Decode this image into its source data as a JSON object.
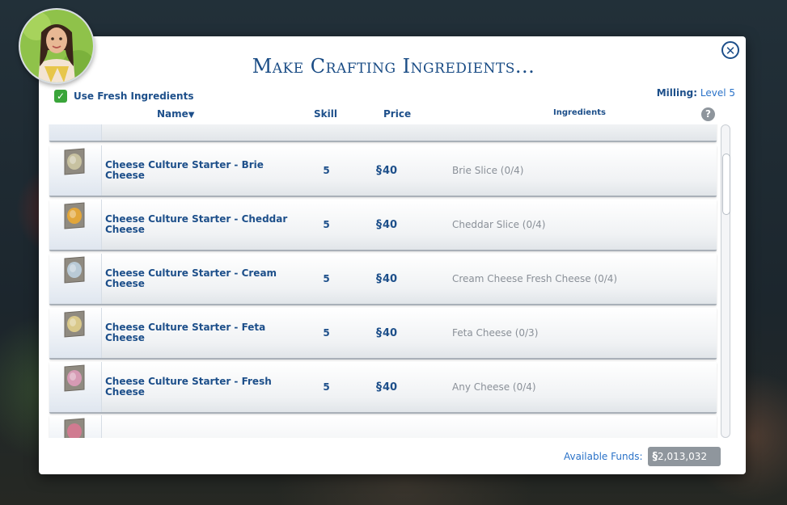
{
  "dialog": {
    "title": "Make Crafting Ingredients...",
    "use_fresh_label": "Use Fresh Ingredients",
    "use_fresh_checked": true,
    "skill_label": "Milling:",
    "skill_level": "Level 5"
  },
  "columns": {
    "name": "Name",
    "skill": "Skill",
    "price": "Price",
    "ingredients": "Ingredients"
  },
  "currency_symbol": "§",
  "rows": [
    {
      "name": "Cheese Culture Starter - Brie Cheese",
      "skill": "5",
      "price": "40",
      "ingredients": "Brie Slice (0/4)",
      "accent": "#c7c1a0"
    },
    {
      "name": "Cheese Culture Starter - Cheddar Cheese",
      "skill": "5",
      "price": "40",
      "ingredients": "Cheddar Slice (0/4)",
      "accent": "#e2a63a"
    },
    {
      "name": "Cheese Culture Starter - Cream Cheese",
      "skill": "5",
      "price": "40",
      "ingredients": "Cream Cheese Fresh Cheese (0/4)",
      "accent": "#b9cad6"
    },
    {
      "name": "Cheese Culture Starter - Feta Cheese",
      "skill": "5",
      "price": "40",
      "ingredients": "Feta Cheese (0/3)",
      "accent": "#d9c88a"
    },
    {
      "name": "Cheese Culture Starter - Fresh Cheese",
      "skill": "5",
      "price": "40",
      "ingredients": "Any Cheese (0/4)",
      "accent": "#d69ab4"
    }
  ],
  "funds": {
    "label": "Available Funds:",
    "value": "2,013,032"
  },
  "icons": {
    "close": "close-icon",
    "help": "help-icon",
    "sort": "sort-down-icon",
    "check": "check-icon"
  }
}
